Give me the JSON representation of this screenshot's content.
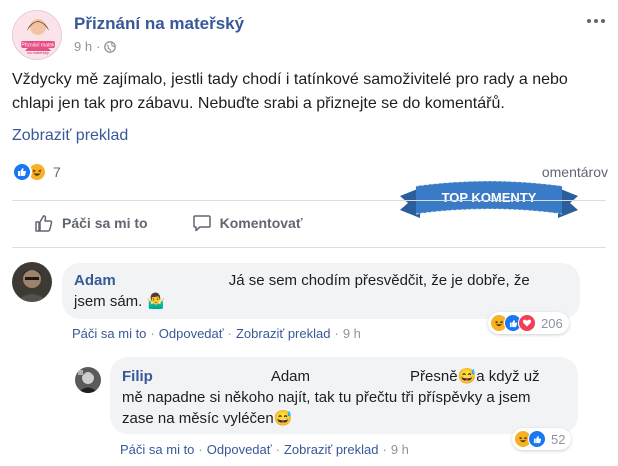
{
  "post": {
    "page_name": "Přiznání na mateřský",
    "avatar_text": [
      "Přiznání matek",
      "na mateřský"
    ],
    "time": "9 h",
    "text": "Vždycky mě zajímalo, jestli tady chodí i tatínkové samoživitelé pro rady a nebo chlapi jen tak pro zábavu. Nebuďte srabi a přiznejte se do komentářů.",
    "translate_label": "Zobraziť preklad",
    "reaction_count": "7",
    "comments_label": "omentárov"
  },
  "badge_text": "TOP KOMENTY",
  "actions": {
    "like_label": "Páči sa mi to",
    "comment_label": "Komentovať"
  },
  "comments": [
    {
      "author": "Adam",
      "text_line1": "Já se sem chodím přesvědčit, že je dobře, že",
      "text_line2": "jsem sám. 🤷‍♂️",
      "like": "Páči sa mi to",
      "reply": "Odpovedať",
      "translate": "Zobraziť preklad",
      "time": "9 h",
      "reaction_count": "206"
    },
    {
      "author": "Filip",
      "mention": "Adam",
      "text_line1": "Přesně😅a když už",
      "text_line2": "mě napadne si někoho najít, tak tu přečtu tři příspěvky a jsem",
      "text_line3": "zase na měsíc vyléčen😅",
      "like": "Páči sa mi to",
      "reply": "Odpovedať",
      "translate": "Zobraziť preklad",
      "time": "9 h",
      "reaction_count": "52"
    }
  ],
  "colors": {
    "link": "#385898",
    "like_blue": "#1877f2",
    "haha_yellow": "#f7b125",
    "love_red": "#f33e58",
    "badge_blue": "#2f6fb3"
  }
}
